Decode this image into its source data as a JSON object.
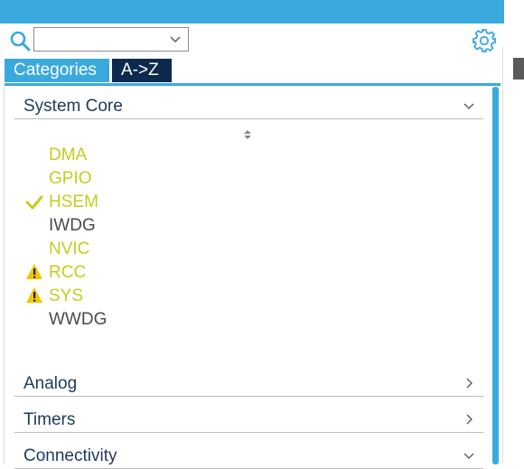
{
  "search": {
    "value": "",
    "placeholder": ""
  },
  "tabs": [
    {
      "label": "Categories",
      "active": true
    },
    {
      "label": "A->Z",
      "active": false
    }
  ],
  "sections": [
    {
      "title": "System Core",
      "expanded": true,
      "items": [
        {
          "label": "DMA",
          "status": "enabled",
          "mark": ""
        },
        {
          "label": "GPIO",
          "status": "enabled",
          "mark": ""
        },
        {
          "label": "HSEM",
          "status": "enabled",
          "mark": "check-icon"
        },
        {
          "label": "IWDG",
          "status": "disabled",
          "mark": ""
        },
        {
          "label": "NVIC",
          "status": "enabled",
          "mark": ""
        },
        {
          "label": "RCC",
          "status": "enabled",
          "mark": "warning-icon"
        },
        {
          "label": "SYS",
          "status": "enabled",
          "mark": "warning-icon"
        },
        {
          "label": "WWDG",
          "status": "disabled",
          "mark": ""
        }
      ]
    },
    {
      "title": "Analog",
      "expanded": false
    },
    {
      "title": "Timers",
      "expanded": false
    },
    {
      "title": "Connectivity",
      "expanded": true
    }
  ],
  "colors": {
    "accent": "#3aa9de",
    "tab_inactive": "#0d2a4e",
    "enabled_text": "#c5cc1d",
    "disabled_text": "#4a4a4a",
    "warning": "#f2c500"
  }
}
